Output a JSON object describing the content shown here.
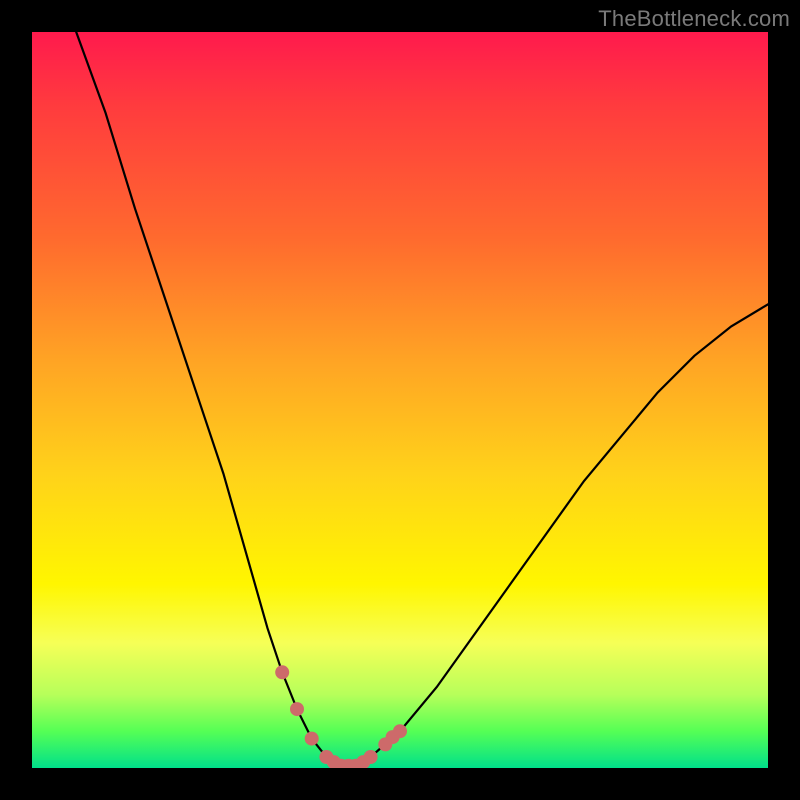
{
  "watermark": "TheBottleneck.com",
  "colors": {
    "background": "#000000",
    "curve": "#000000",
    "markers": "#cd6a6a",
    "gradient_top": "#ff1a4d",
    "gradient_mid": "#fff600",
    "gradient_bottom": "#00e08a"
  },
  "chart_data": {
    "type": "line",
    "title": "",
    "xlabel": "",
    "ylabel": "",
    "xlim": [
      0,
      100
    ],
    "ylim": [
      0,
      100
    ],
    "grid": false,
    "legend": false,
    "series": [
      {
        "name": "bottleneck-curve",
        "x": [
          6,
          10,
          14,
          18,
          22,
          26,
          28,
          30,
          32,
          34,
          36,
          38,
          40,
          42,
          44,
          46,
          50,
          55,
          60,
          65,
          70,
          75,
          80,
          85,
          90,
          95,
          100
        ],
        "values": [
          100,
          89,
          76,
          64,
          52,
          40,
          33,
          26,
          19,
          13,
          8,
          4,
          1.5,
          0.3,
          0.3,
          1.5,
          5,
          11,
          18,
          25,
          32,
          39,
          45,
          51,
          56,
          60,
          63
        ]
      }
    ],
    "markers": {
      "name": "highlight-dots",
      "x": [
        34,
        36,
        38,
        40,
        41,
        42,
        43,
        44,
        45,
        46,
        48,
        49,
        50
      ],
      "values": [
        13,
        8,
        4,
        1.5,
        0.8,
        0.3,
        0.3,
        0.3,
        0.8,
        1.5,
        3.2,
        4.2,
        5
      ]
    }
  }
}
